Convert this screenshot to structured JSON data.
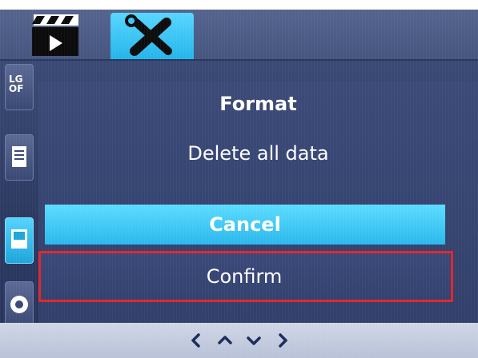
{
  "tabs": [
    {
      "id": "video",
      "icon": "video-clapper-icon",
      "selected": false
    },
    {
      "id": "settings",
      "icon": "tools-icon",
      "selected": true
    }
  ],
  "sidebar": {
    "items": [
      {
        "icon": "language-icon",
        "text_lines": [
          "LG",
          "OF"
        ],
        "selected": false
      },
      {
        "icon": "document-icon",
        "selected": false
      },
      {
        "icon": "sd-card-icon",
        "selected": true
      },
      {
        "icon": "gear-icon",
        "selected": false
      }
    ]
  },
  "dialog": {
    "title": "Format",
    "message": "Delete all data",
    "buttons": {
      "cancel": "Cancel",
      "confirm": "Confirm"
    }
  },
  "navigation": {
    "icons": [
      "chevron-left-icon",
      "chevron-up-icon",
      "chevron-down-icon",
      "chevron-right-icon"
    ]
  },
  "colors": {
    "accent": "#2bb8ec",
    "highlight": "#e3262b",
    "screen_bg": "#2c3a62"
  }
}
